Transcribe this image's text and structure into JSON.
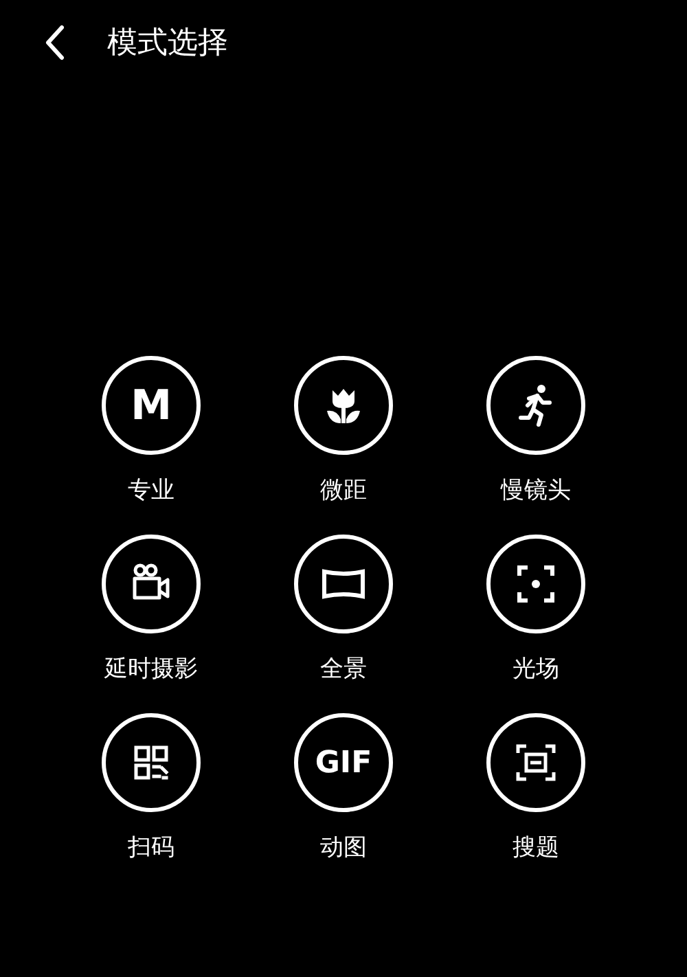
{
  "header": {
    "title": "模式选择"
  },
  "modes": [
    {
      "label": "专业",
      "kind": "text",
      "glyph": "M"
    },
    {
      "label": "微距",
      "kind": "flower"
    },
    {
      "label": "慢镜头",
      "kind": "runner"
    },
    {
      "label": "延时摄影",
      "kind": "camera"
    },
    {
      "label": "全景",
      "kind": "panorama"
    },
    {
      "label": "光场",
      "kind": "focus"
    },
    {
      "label": "扫码",
      "kind": "qr"
    },
    {
      "label": "动图",
      "kind": "text",
      "glyph": "GIF"
    },
    {
      "label": "搜题",
      "kind": "scan"
    }
  ]
}
